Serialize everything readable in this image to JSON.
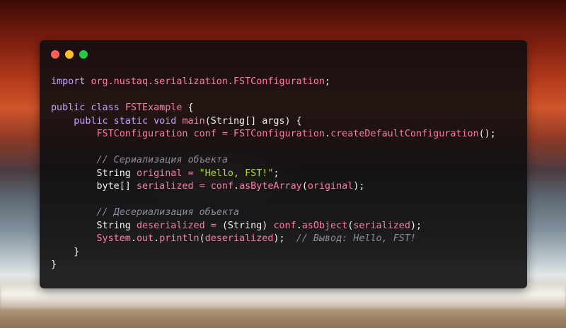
{
  "window": {
    "title_dots": [
      "close",
      "minimize",
      "maximize"
    ],
    "colors": {
      "red": "#ff5f56",
      "yellow": "#ffbd2e",
      "green": "#27c93f"
    }
  },
  "code": {
    "language": "java",
    "l1": {
      "kw": "import",
      "pkg": "org.nustaq.serialization.FSTConfiguration",
      "end": ";"
    },
    "l3": {
      "kw": "public class",
      "cls": "FSTExample",
      "end": "{"
    },
    "l4": {
      "indent": "    ",
      "kw": "public static void",
      "meth": "main",
      "params": "(String[] args) {"
    },
    "l5": {
      "indent": "        ",
      "type": "FSTConfiguration",
      "var": "conf",
      "eq": "=",
      "obj": "FSTConfiguration",
      "dot": ".",
      "meth": "createDefaultConfiguration",
      "end": "();"
    },
    "l7": {
      "indent": "        ",
      "comment": "// Сериализация объекта"
    },
    "l8": {
      "indent": "        ",
      "type": "String",
      "var": "original",
      "eq": "=",
      "str": "\"Hello, FST!\"",
      "end": ";"
    },
    "l9": {
      "indent": "        ",
      "type": "byte[]",
      "var": "serialized",
      "eq": "=",
      "obj": "conf",
      "dot": ".",
      "meth": "asByteArray",
      "open": "(",
      "arg": "original",
      "end": ");"
    },
    "l11": {
      "indent": "        ",
      "comment": "// Десериализация объекта"
    },
    "l12": {
      "indent": "        ",
      "type": "String",
      "var": "deserialized",
      "eq": "=",
      "cast": "(String)",
      "obj": "conf",
      "dot": ".",
      "meth": "asObject",
      "open": "(",
      "arg": "serialized",
      "end": ");"
    },
    "l13": {
      "indent": "        ",
      "obj1": "System",
      "dot1": ".",
      "obj2": "out",
      "dot2": ".",
      "meth": "println",
      "open": "(",
      "arg": "deserialized",
      "end": ");",
      "comment": "// Вывод: Hello, FST!"
    },
    "l14": {
      "indent": "    ",
      "end": "}"
    },
    "l15": {
      "end": "}"
    }
  }
}
